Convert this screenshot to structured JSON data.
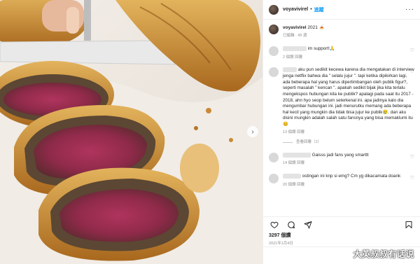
{
  "post": {
    "username": "voyavivirel",
    "follow_label": "追蹤",
    "caption_user": "voyavivirel",
    "caption_text": "2021 🍝",
    "caption_meta": "已編輯 · 45 週"
  },
  "comments": [
    {
      "text": "im support!🙏",
      "meta": "2 個讚  回覆"
    },
    {
      "text": "aku pun sedikit kecewa karena dia mengatakan di interview jenga netflix bahwa dia \" selalu jujur \". tapi ketika dipikirkan lagi, ada beberapa hal yang harus dipertimbangan oleh publik figur?, seperti masalah \" kencan \". apakah sedikit bijak jika kita terlalu mengekspos hubungan kita ke publik? apalagi pada saat itu 2017 - 2018, ahn hyo seop belum seterkenal ini. apa jadinya kalo dia mengumbar hubungan ini. jadi menurutku memang ada beberapa hal kecil yang mungkin dia tidak bisa jujur ke publik😢. dan aku disini mungkin adalah salah satu fansnya yang bisa memaklumi itu 😊",
      "meta": "13 個讚  回覆",
      "replies": "查看回覆（1）"
    },
    {
      "text": "Gaisss jadi fans yang smarttt",
      "meta": "14 個讚  回覆"
    },
    {
      "text": "ostingan ini knp si emg? Cm yg dikacamata doank",
      "meta": "20 個讚  回覆"
    }
  ],
  "engagement": {
    "likes": "3297 個讚",
    "date": "2021年1月4日"
  },
  "watermark": "大英叔叔有话说",
  "icons": [
    "heart-icon",
    "comment-icon",
    "share-icon",
    "bookmark-icon"
  ],
  "colors": {
    "link_blue": "#0095f6",
    "text": "#262626",
    "muted": "#8e8e8e"
  }
}
